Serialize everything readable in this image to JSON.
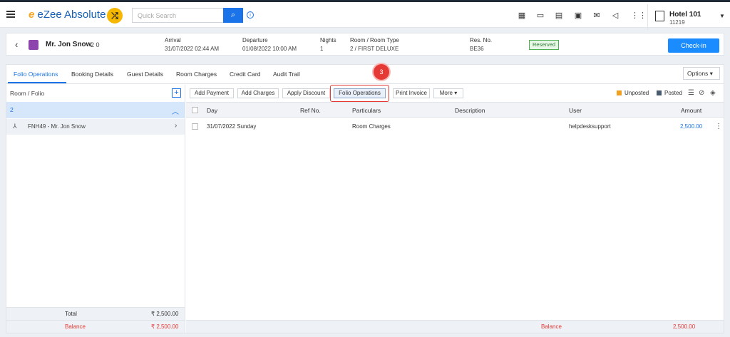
{
  "app": {
    "name": "eZee Absolute",
    "logo_mark": "e"
  },
  "search": {
    "placeholder": "Quick Search"
  },
  "hotel": {
    "name": "Hotel 101",
    "code": "11219"
  },
  "guest": {
    "name": "Mr. Jon Snow",
    "pax": "2  0",
    "arrival_label": "Arrival",
    "arrival_value": "31/07/2022 02:44 AM",
    "departure_label": "Departure",
    "departure_value": "01/08/2022 10:00 AM",
    "nights_label": "Nights",
    "nights_value": "1",
    "room_label": "Room / Room Type",
    "room_value": "2 / FIRST DELUXE",
    "resno_label": "Res. No.",
    "resno_value": "BE36",
    "status": "Reserved",
    "checkin_label": "Check-in"
  },
  "tabs": [
    {
      "label": "Folio Operations",
      "active": true
    },
    {
      "label": "Booking Details"
    },
    {
      "label": "Guest Details"
    },
    {
      "label": "Room Charges"
    },
    {
      "label": "Credit Card"
    },
    {
      "label": "Audit Trail"
    }
  ],
  "options_label": "Options",
  "step_badge": "3",
  "left_panel": {
    "header": "Room / Folio",
    "group": "2",
    "folio": "FNH49 - Mr. Jon Snow",
    "total_label": "Total",
    "total_value": "₹ 2,500.00",
    "balance_label": "Balance",
    "balance_value": "₹ 2,500.00"
  },
  "toolbar": {
    "add_payment": "Add Payment",
    "add_charges": "Add Charges",
    "apply_discount": "Apply Discount",
    "folio_operations": "Folio Operations",
    "print_invoice": "Print Invoice",
    "more": "More"
  },
  "legend": {
    "unposted": "Unposted",
    "posted": "Posted",
    "unposted_color": "#f0a020",
    "posted_color": "#4a5a6e"
  },
  "table": {
    "columns": [
      "Day",
      "Ref No.",
      "Particulars",
      "Description",
      "User",
      "Amount"
    ],
    "rows": [
      {
        "day": "31/07/2022 Sunday",
        "ref": "",
        "particulars": "Room Charges",
        "description": "",
        "user": "helpdesksupport",
        "amount": "2,500.00"
      }
    ],
    "balance_label": "Balance",
    "balance_value": "2,500.00"
  }
}
